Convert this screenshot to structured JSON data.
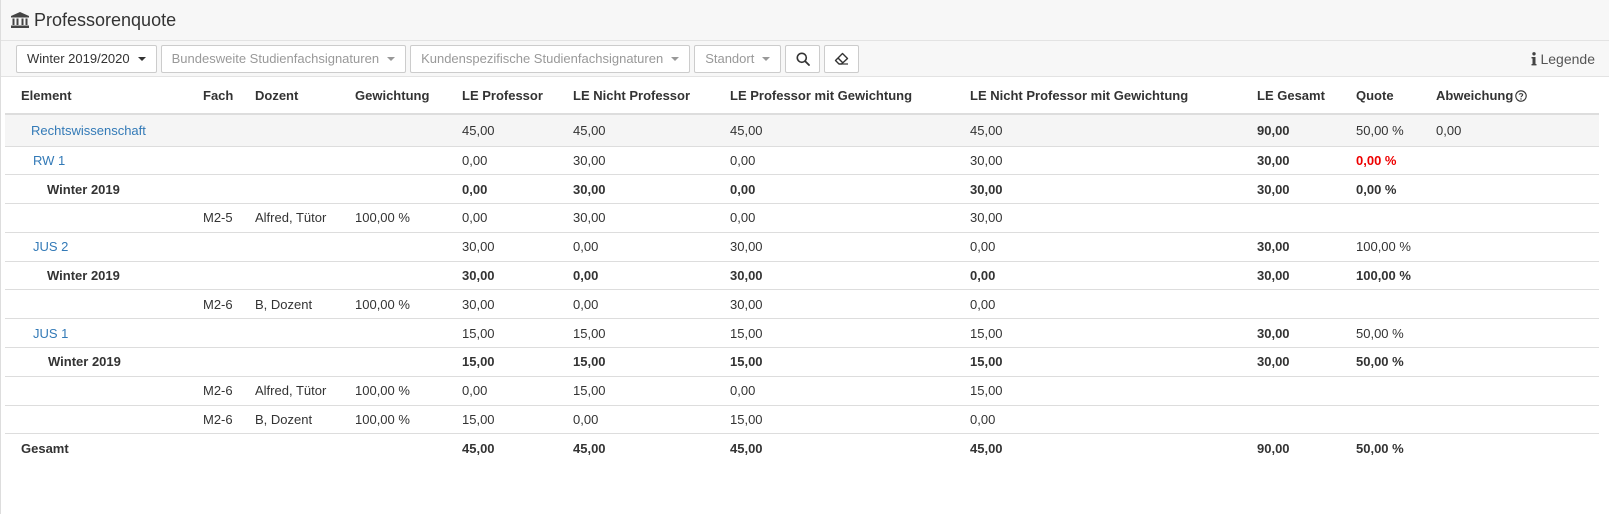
{
  "header": {
    "title": "Professorenquote"
  },
  "toolbar": {
    "semester": "Winter 2019/2020",
    "bundesweit": "Bundesweite Studienfachsignaturen",
    "kundenspezifisch": "Kundenspezifische Studienfachsignaturen",
    "standort": "Standort",
    "legend": "Legende"
  },
  "colors": {
    "link": "#337ab7",
    "negative": "#ee0000",
    "header_bg": "#f7f7f7"
  },
  "table": {
    "columns": {
      "element": "Element",
      "fach": "Fach",
      "dozent": "Dozent",
      "gewichtung": "Gewichtung",
      "le_prof": "LE Professor",
      "le_nicht": "LE Nicht Professor",
      "le_prof_gew": "LE Professor mit Gewichtung",
      "le_nicht_gew": "LE Nicht Professor mit Gewichtung",
      "le_gesamt": "LE Gesamt",
      "quote": "Quote",
      "abweichung": "Abweichung"
    },
    "rows": [
      {
        "element": "Rechtswissenschaft",
        "fach": "",
        "dozent": "",
        "gew": "",
        "lp": "45,00",
        "ln": "45,00",
        "lpg": "45,00",
        "lng": "45,00",
        "ges": "90,00",
        "quote": "50,00 %",
        "abw": "0,00"
      },
      {
        "element": "RW 1",
        "fach": "",
        "dozent": "",
        "gew": "",
        "lp": "0,00",
        "ln": "30,00",
        "lpg": "0,00",
        "lng": "30,00",
        "ges": "30,00",
        "quote": "0,00 %",
        "abw": ""
      },
      {
        "element": "Winter 2019",
        "fach": "",
        "dozent": "",
        "gew": "",
        "lp": "0,00",
        "ln": "30,00",
        "lpg": "0,00",
        "lng": "30,00",
        "ges": "30,00",
        "quote": "0,00 %",
        "abw": ""
      },
      {
        "element": "",
        "fach": "M2-5",
        "dozent": "Alfred, Tütor",
        "gew": "100,00 %",
        "lp": "0,00",
        "ln": "30,00",
        "lpg": "0,00",
        "lng": "30,00",
        "ges": "",
        "quote": "",
        "abw": ""
      },
      {
        "element": "JUS 2",
        "fach": "",
        "dozent": "",
        "gew": "",
        "lp": "30,00",
        "ln": "0,00",
        "lpg": "30,00",
        "lng": "0,00",
        "ges": "30,00",
        "quote": "100,00 %",
        "abw": ""
      },
      {
        "element": "Winter 2019",
        "fach": "",
        "dozent": "",
        "gew": "",
        "lp": "30,00",
        "ln": "0,00",
        "lpg": "30,00",
        "lng": "0,00",
        "ges": "30,00",
        "quote": "100,00 %",
        "abw": ""
      },
      {
        "element": "",
        "fach": "M2-6",
        "dozent": "B, Dozent",
        "gew": "100,00 %",
        "lp": "30,00",
        "ln": "0,00",
        "lpg": "30,00",
        "lng": "0,00",
        "ges": "",
        "quote": "",
        "abw": ""
      },
      {
        "element": "JUS 1",
        "fach": "",
        "dozent": "",
        "gew": "",
        "lp": "15,00",
        "ln": "15,00",
        "lpg": "15,00",
        "lng": "15,00",
        "ges": "30,00",
        "quote": "50,00 %",
        "abw": ""
      },
      {
        "element": "Winter 2019",
        "fach": "",
        "dozent": "",
        "gew": "",
        "lp": "15,00",
        "ln": "15,00",
        "lpg": "15,00",
        "lng": "15,00",
        "ges": "30,00",
        "quote": "50,00 %",
        "abw": ""
      },
      {
        "element": "",
        "fach": "M2-6",
        "dozent": "Alfred, Tütor",
        "gew": "100,00 %",
        "lp": "0,00",
        "ln": "15,00",
        "lpg": "0,00",
        "lng": "15,00",
        "ges": "",
        "quote": "",
        "abw": ""
      },
      {
        "element": "",
        "fach": "M2-6",
        "dozent": "B, Dozent",
        "gew": "100,00 %",
        "lp": "15,00",
        "ln": "0,00",
        "lpg": "15,00",
        "lng": "0,00",
        "ges": "",
        "quote": "",
        "abw": ""
      },
      {
        "element": "Gesamt",
        "fach": "",
        "dozent": "",
        "gew": "",
        "lp": "45,00",
        "ln": "45,00",
        "lpg": "45,00",
        "lng": "45,00",
        "ges": "90,00",
        "quote": "50,00 %",
        "abw": ""
      }
    ]
  }
}
